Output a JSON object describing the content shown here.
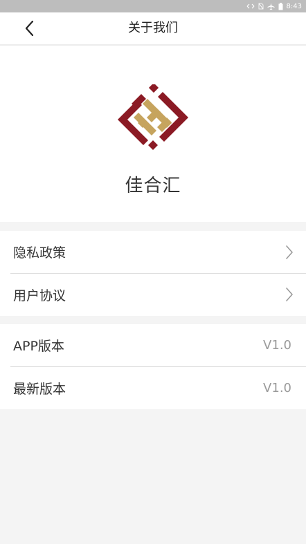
{
  "status_bar": {
    "time": "8:43",
    "icons": [
      "data-arrows-icon",
      "no-sim-icon",
      "airplane-icon",
      "battery-icon"
    ]
  },
  "nav": {
    "title": "关于我们",
    "back_icon": "chevron-left-icon"
  },
  "about": {
    "app_name": "佳合汇",
    "logo_colors": {
      "dark_red": "#8b1a24",
      "gold": "#c6a45e"
    }
  },
  "links": [
    {
      "label": "隐私政策",
      "icon": "chevron-right-icon"
    },
    {
      "label": "用户协议",
      "icon": "chevron-right-icon"
    }
  ],
  "versions": [
    {
      "label": "APP版本",
      "value": "V1.0"
    },
    {
      "label": "最新版本",
      "value": "V1.0"
    }
  ]
}
